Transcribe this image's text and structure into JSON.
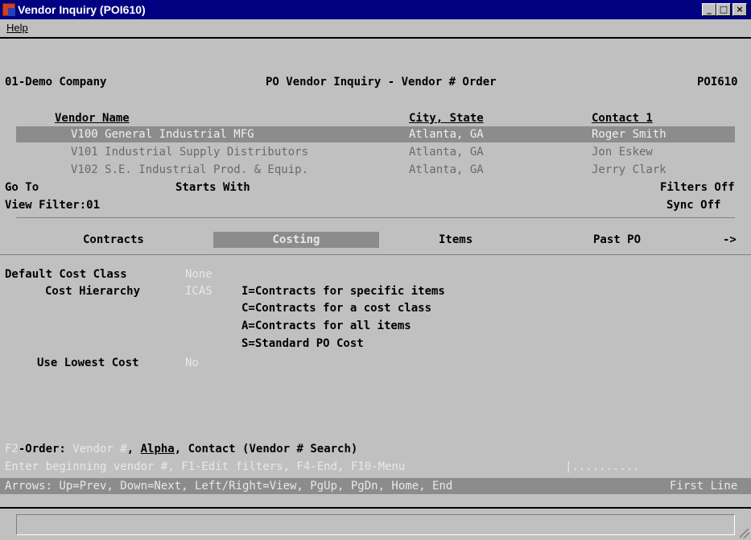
{
  "window": {
    "title": "Vendor Inquiry (POI610)",
    "min_label": "_",
    "max_label": "□",
    "close_label": "×"
  },
  "menu": {
    "help_label": "Help"
  },
  "header": {
    "company": "01-Demo Company",
    "title": "PO Vendor Inquiry - Vendor # Order",
    "program": "POI610"
  },
  "list": {
    "col_vendor": "Vendor Name",
    "col_city": "City, State",
    "col_contact": "Contact 1",
    "rows": [
      {
        "vendor": "V100 General Industrial MFG",
        "city": "Atlanta, GA",
        "contact": "Roger Smith"
      },
      {
        "vendor": "V101 Industrial Supply Distributors",
        "city": "Atlanta, GA",
        "contact": "Jon Eskew"
      },
      {
        "vendor": "V102 S.E. Industrial Prod. & Equip.",
        "city": "Atlanta, GA",
        "contact": "Jerry Clark"
      }
    ],
    "selected_index": 0
  },
  "search": {
    "goto_label": "Go To",
    "starts_with_label": "Starts With",
    "filters_label": "Filters Off",
    "view_filter_label": "View Filter:01",
    "sync_label": "Sync Off"
  },
  "tabs": [
    {
      "label": "Contracts"
    },
    {
      "label": "Costing"
    },
    {
      "label": "Items"
    },
    {
      "label": "Past PO"
    },
    {
      "label": "->"
    }
  ],
  "active_tab": "Costing",
  "costing": {
    "default_cost_class_label": "Default Cost Class",
    "default_cost_class_value": "None",
    "cost_hierarchy_label": "Cost Hierarchy",
    "cost_hierarchy_value": "ICAS",
    "legend": [
      "I=Contracts for specific items",
      "C=Contracts for a cost class",
      "A=Contracts for all items",
      "S=Standard PO Cost"
    ],
    "use_lowest_cost_label": "Use Lowest Cost",
    "use_lowest_cost_value": "No"
  },
  "footer": {
    "order_prefix": "F2-Order: ",
    "order_vendor": "Vendor #",
    "order_sep1": ", ",
    "order_alpha": "Alpha",
    "order_sep2": ", ",
    "order_contact": "Contact",
    "order_suffix": " (Vendor # Search)",
    "prompt": "Enter beginning vendor #, F1-Edit filters, F4-End, F10-Menu",
    "input_value": "|..........",
    "arrows_help": "Arrows: Up=Prev, Down=Next, Left/Right=View, PgUp, PgDn, Home, End",
    "line_status": "First Line"
  },
  "status_bar": {
    "text": ""
  }
}
